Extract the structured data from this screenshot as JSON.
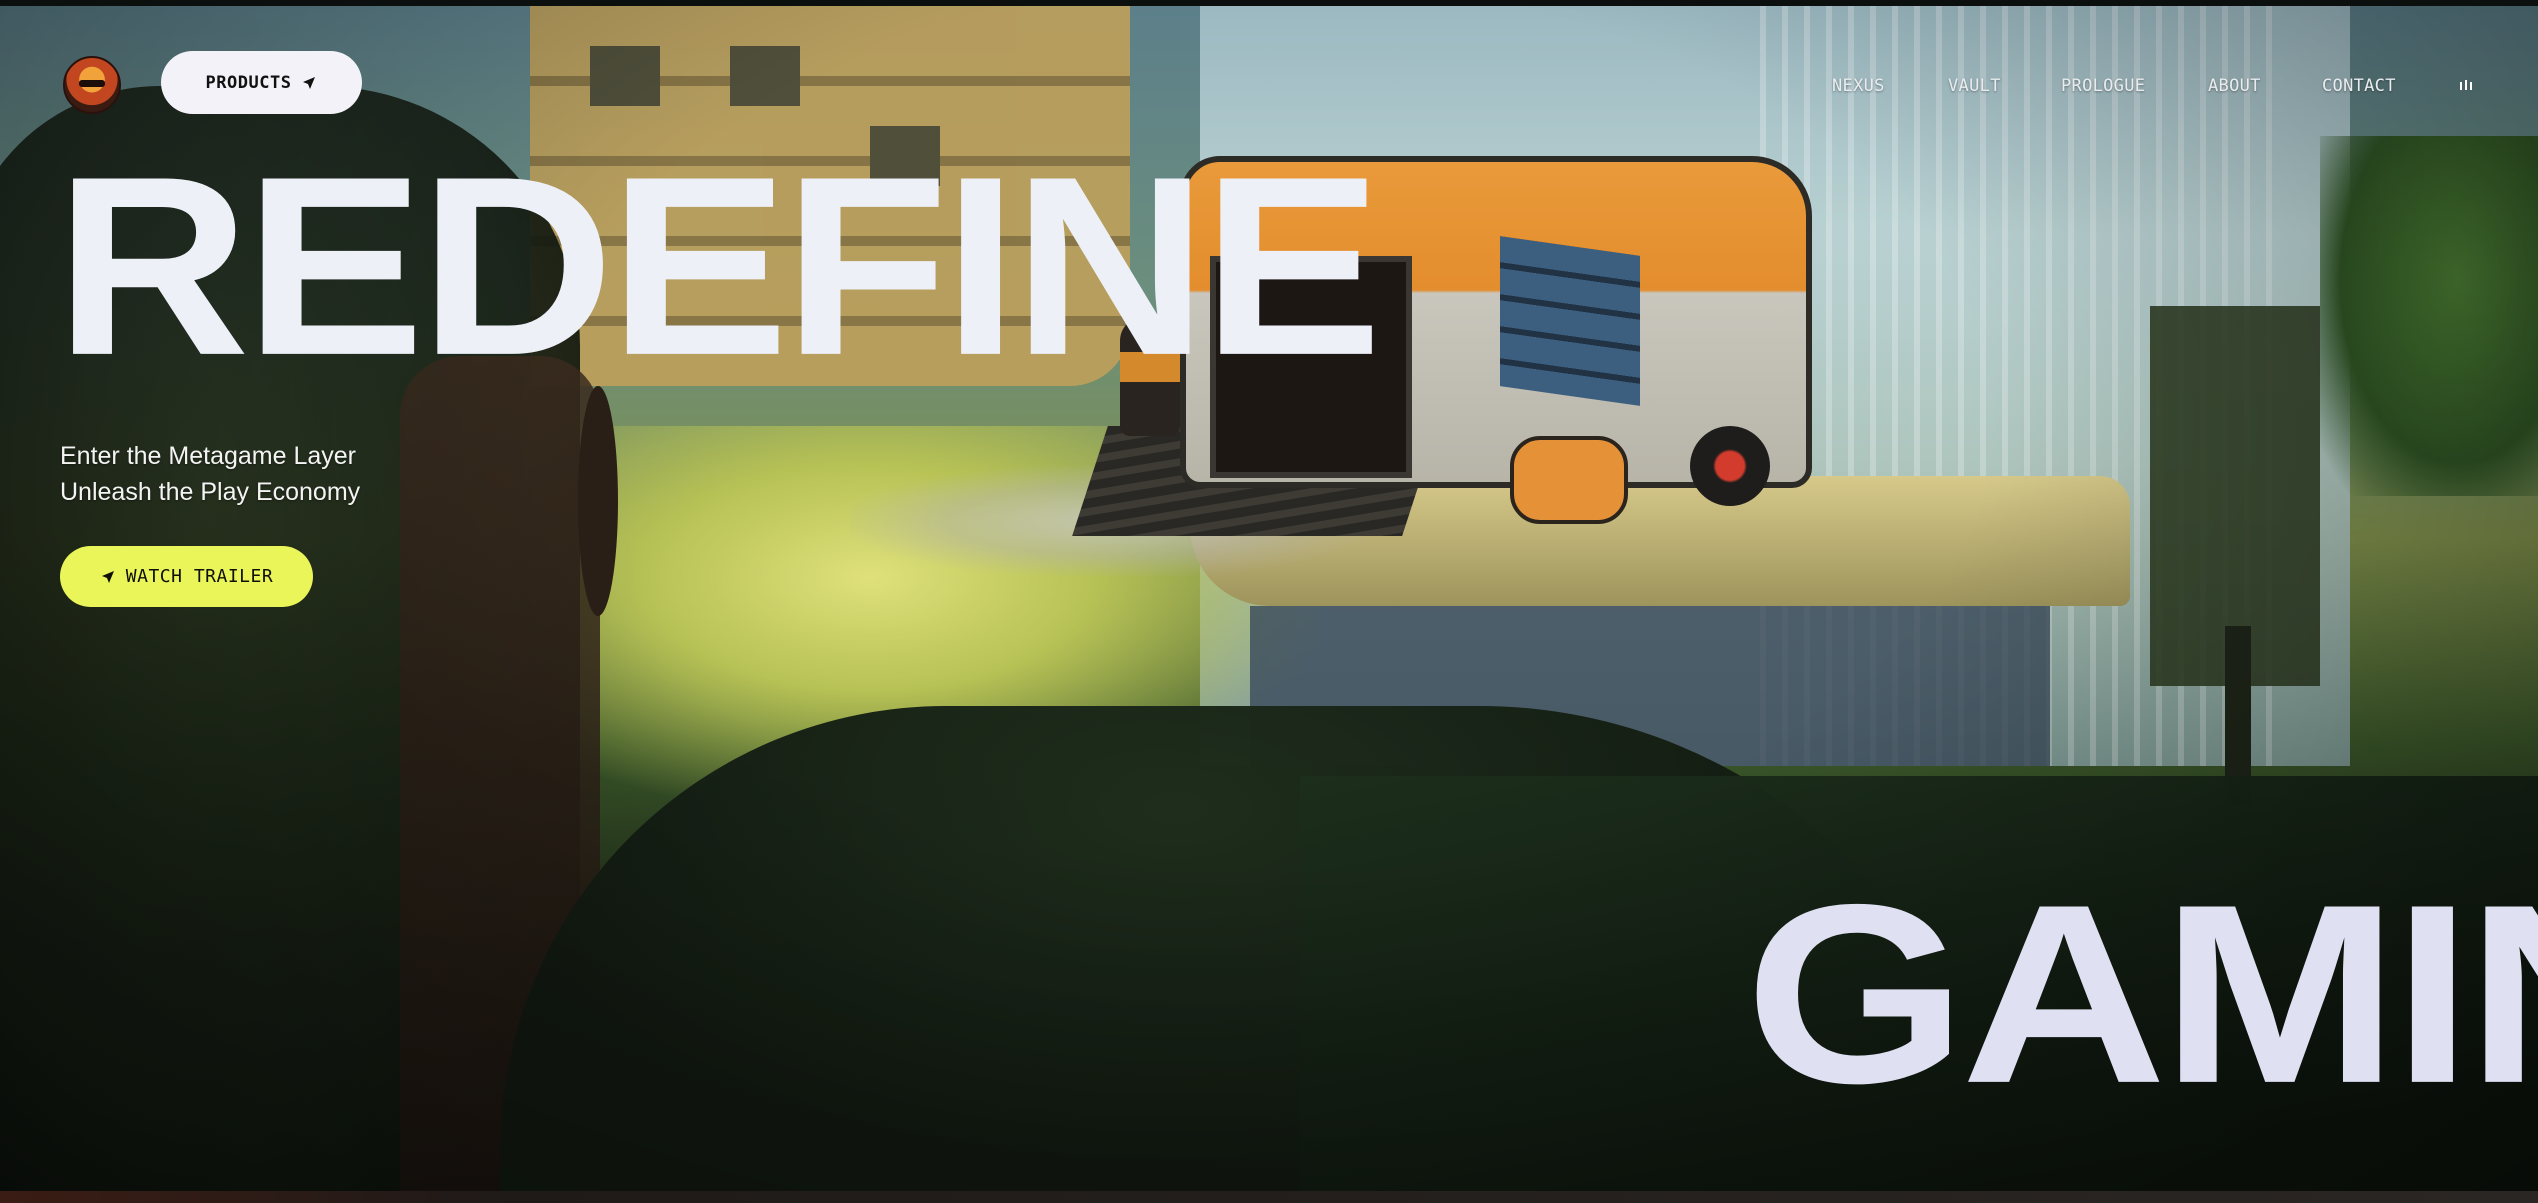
{
  "header": {
    "products_label": "PRODUCTS",
    "nav": [
      {
        "id": "nexus",
        "label": "NEXUS"
      },
      {
        "id": "vault",
        "label": "VAULT"
      },
      {
        "id": "prologue",
        "label": "PROLOGUE"
      },
      {
        "id": "about",
        "label": "ABOUT"
      },
      {
        "id": "contact",
        "label": "CONTACT"
      }
    ]
  },
  "hero": {
    "title_top": "REDEFINE",
    "title_bottom": "GAMING",
    "tagline_1": "Enter the Metagame Layer",
    "tagline_2": "Unleash the Play Economy",
    "cta_label": "WATCH TRAILER"
  },
  "colors": {
    "cta_bg": "#eaf55a",
    "products_bg": "#f3f2f8",
    "title_text": "#eef0f8"
  },
  "icons": {
    "logo": "logo-icon",
    "products_arrow": "arrow-icon",
    "cta_arrow": "arrow-icon",
    "audio": "audio-indicator-icon"
  }
}
